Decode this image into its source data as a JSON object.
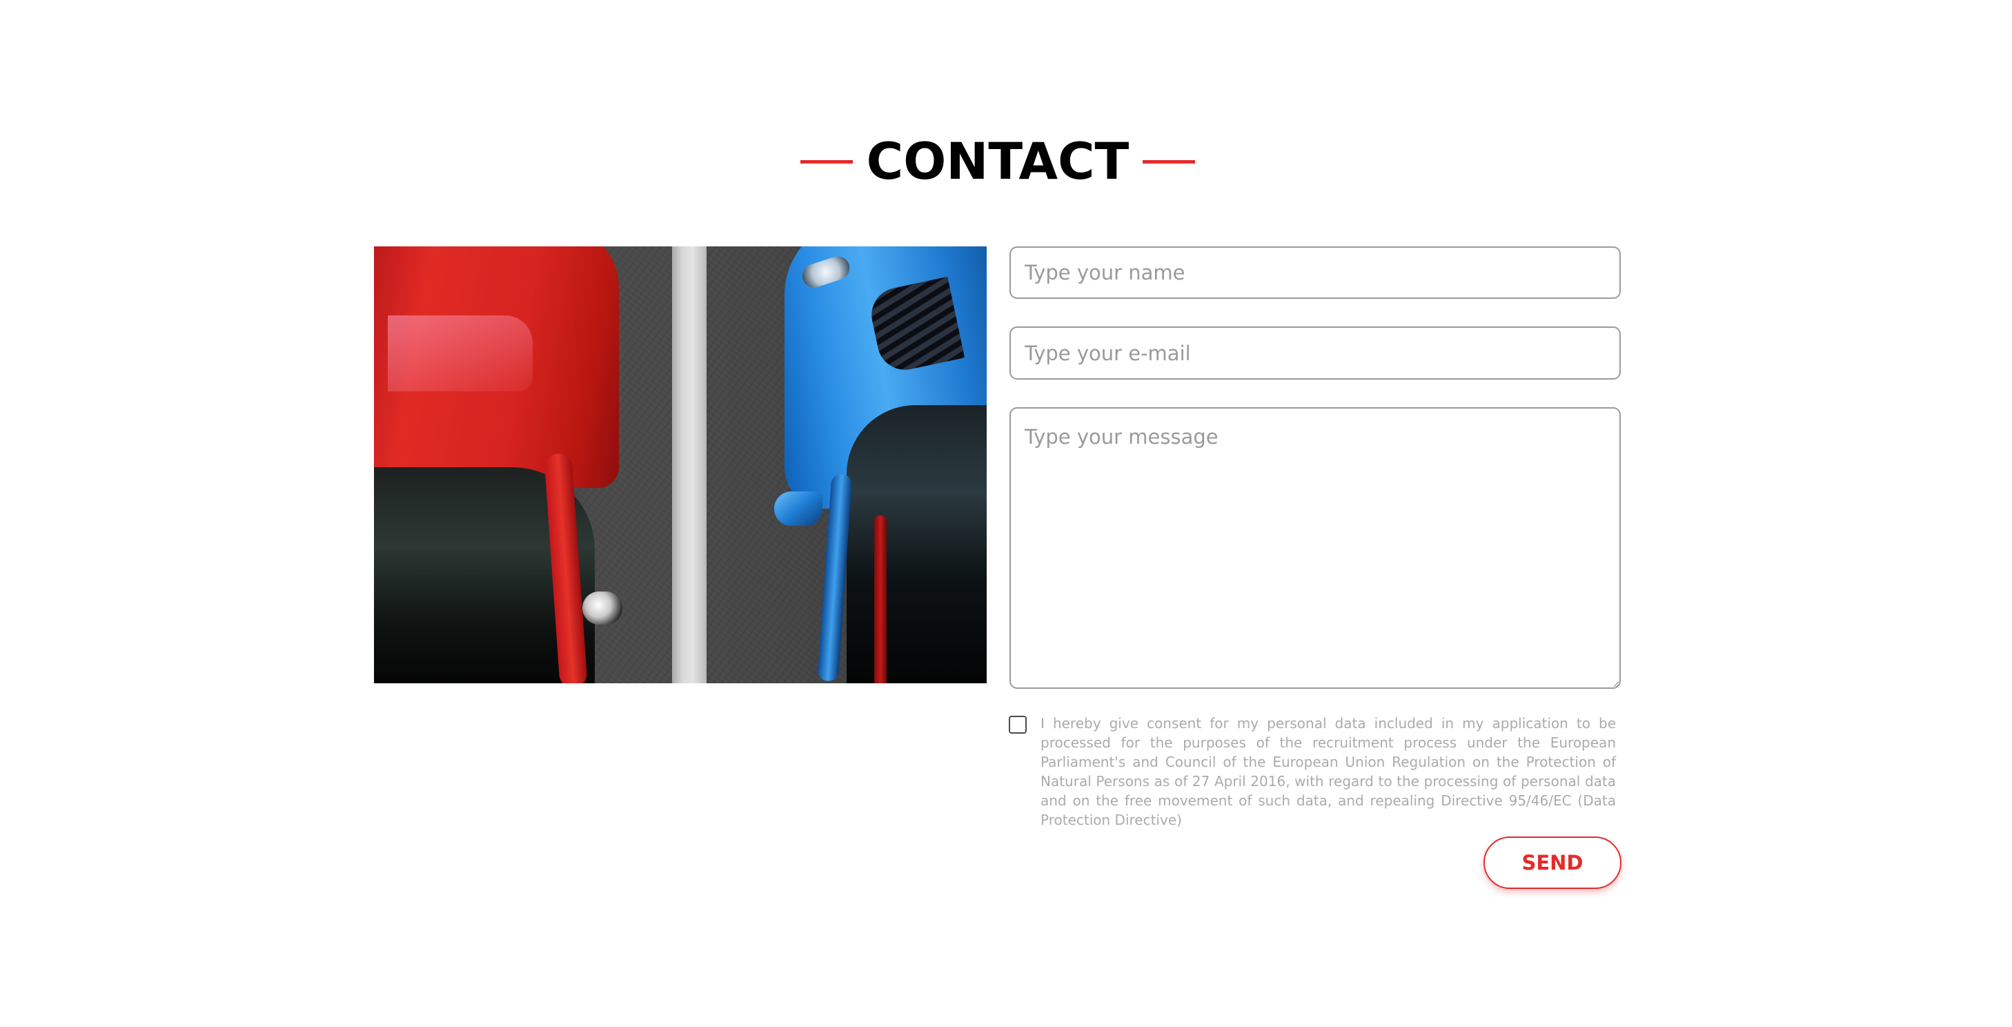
{
  "section": {
    "title": "CONTACT",
    "accent_color": "#e32b2b"
  },
  "image": {
    "description_icon": "parked-cars-photo"
  },
  "form": {
    "name_placeholder": "Type your name",
    "email_placeholder": "Type your e-mail",
    "message_placeholder": "Type your message",
    "consent_checked": false,
    "consent_text": "I hereby give consent for my personal data included in my application to be processed for the purposes of the recruitment process under the European Parliament's and Council of the European Union Regulation on the Protection of Natural Persons as of 27 April 2016, with regard to the processing of personal data and on the free movement of such data, and repealing Directive 95/46/EC (Data Protection Directive)",
    "send_label": "SEND"
  }
}
